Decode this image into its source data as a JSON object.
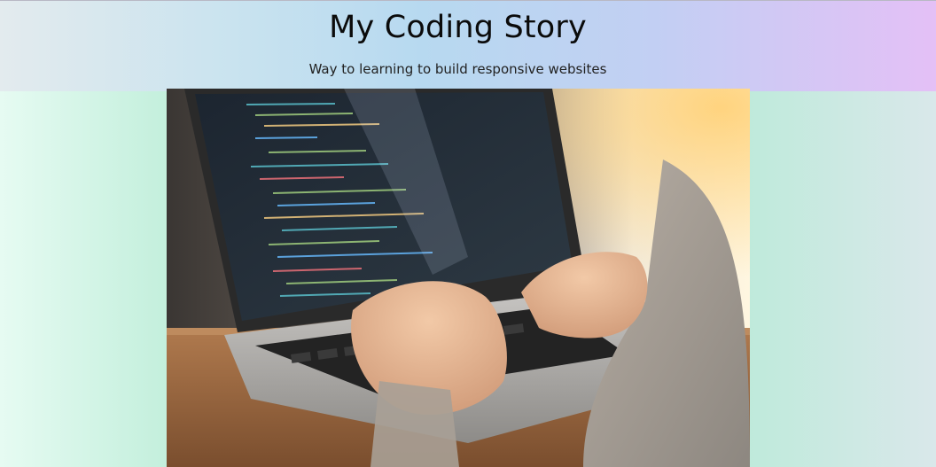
{
  "header": {
    "title": "My Coding Story",
    "subtitle": "Way to learning to build responsive websites"
  },
  "hero": {
    "image_alt": "Person typing code on a laptop"
  }
}
